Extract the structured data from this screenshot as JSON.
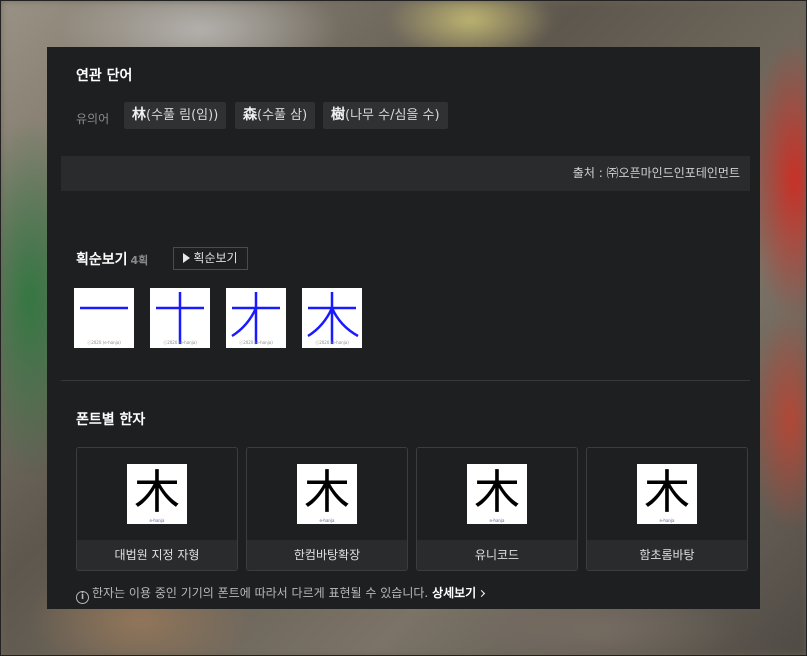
{
  "related": {
    "title": "연관 단어",
    "synonym_label": "유의어",
    "synonyms": [
      {
        "hanja": "林",
        "reading": "(수풀 림(임))"
      },
      {
        "hanja": "森",
        "reading": "(수풀 삼)"
      },
      {
        "hanja": "樹",
        "reading": "(나무 수/심을 수)"
      }
    ],
    "source": "출처 : ㈜오픈마인드인포테인먼트"
  },
  "stroke_order": {
    "title": "획순보기",
    "count": "4획",
    "button_label": "획순보기",
    "copyright": "ⓒ2020 (e-hanja)"
  },
  "font_section": {
    "title": "폰트별 한자",
    "glyph": "木",
    "copyright": "e-hanja",
    "fonts": [
      "대법원 지정 자형",
      "한컴바탕확장",
      "유니코드",
      "함초롬바탕"
    ],
    "notice": "한자는 이용 중인 기기의 폰트에 따라서 다르게 표현될 수 있습니다.",
    "more_label": "상세보기"
  },
  "colors": {
    "panel_bg": "#1e1f21",
    "stroke_color": "#1a1aff"
  }
}
